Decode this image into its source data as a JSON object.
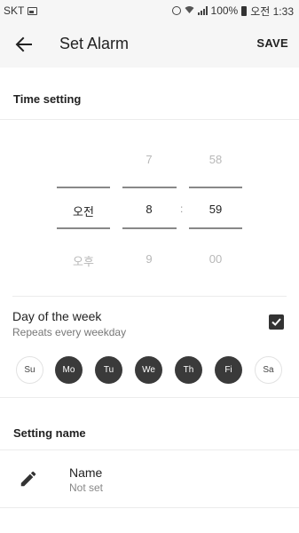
{
  "status_bar": {
    "carrier": "SKT",
    "battery": "100%",
    "time": "오전 1:33"
  },
  "app_bar": {
    "title": "Set Alarm",
    "save_label": "SAVE",
    "back_icon": "arrow-back-icon"
  },
  "time_setting": {
    "header": "Time setting",
    "ampm": {
      "above": "",
      "selected": "오전",
      "below": "오후"
    },
    "hour": {
      "above": "7",
      "selected": "8",
      "below": "9"
    },
    "minute": {
      "above": "58",
      "selected": "59",
      "below": "00"
    },
    "separator": ":"
  },
  "day_of_week": {
    "title": "Day of the week",
    "subtitle": "Repeats every weekday",
    "checked": true,
    "days": [
      {
        "label": "Su",
        "on": false
      },
      {
        "label": "Mo",
        "on": true
      },
      {
        "label": "Tu",
        "on": true
      },
      {
        "label": "We",
        "on": true
      },
      {
        "label": "Th",
        "on": true
      },
      {
        "label": "Fi",
        "on": true
      },
      {
        "label": "Sa",
        "on": false
      }
    ]
  },
  "setting_name": {
    "header": "Setting name",
    "label": "Name",
    "value": "Not set",
    "icon": "pencil-icon"
  }
}
